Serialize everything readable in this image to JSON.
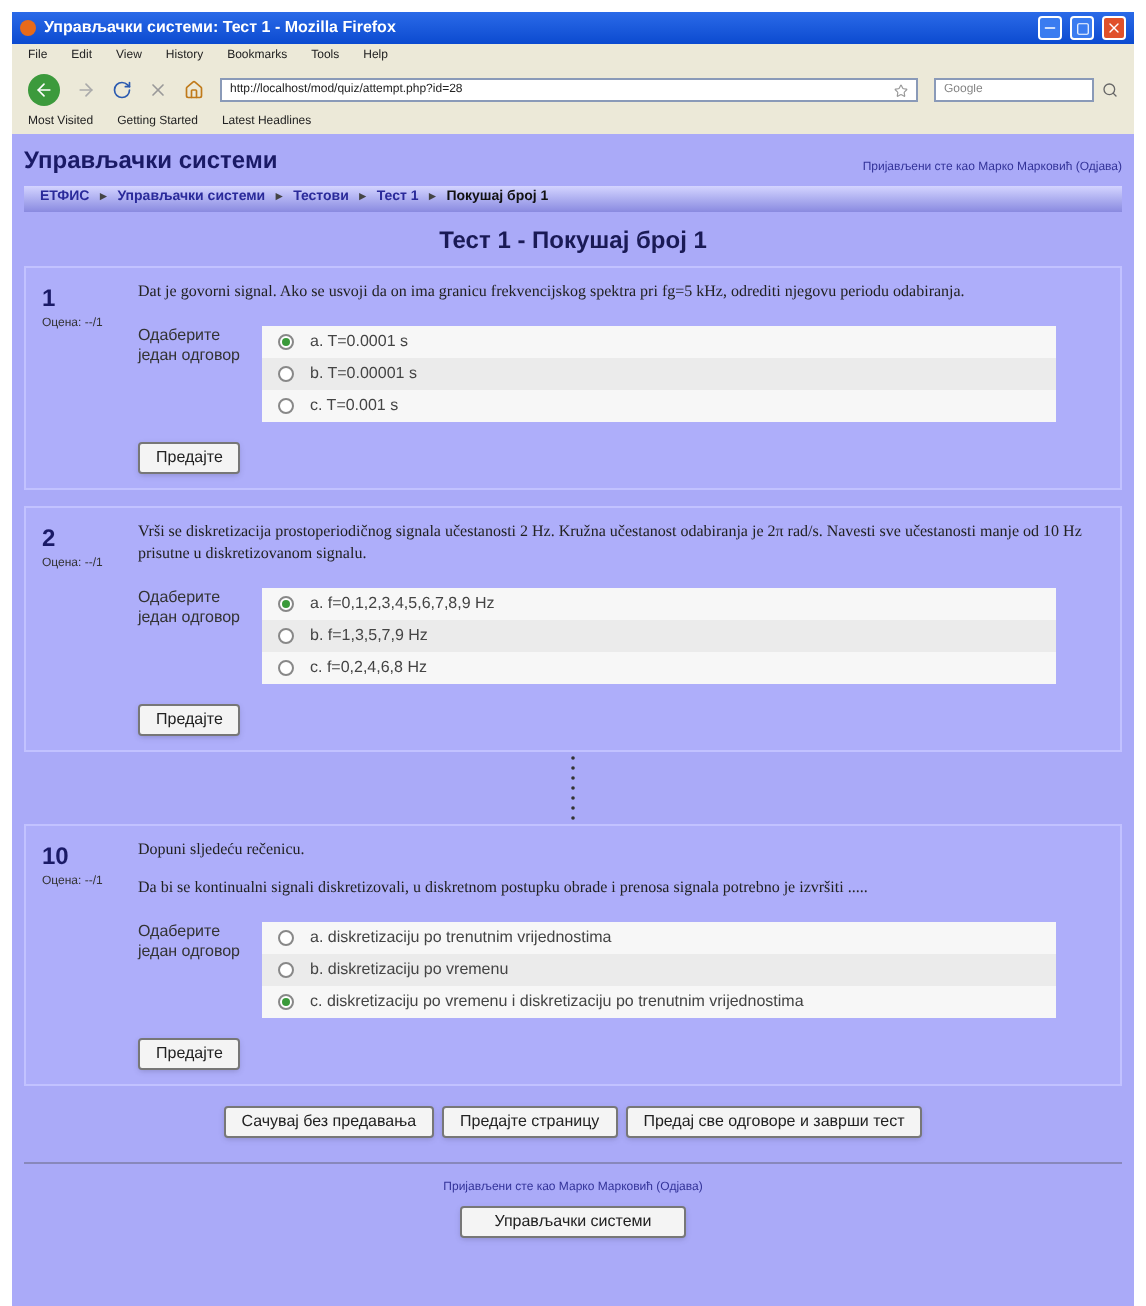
{
  "browser": {
    "title": "Управљачки системи: Тест 1 - Mozilla Firefox",
    "menu": [
      "File",
      "Edit",
      "View",
      "History",
      "Bookmarks",
      "Tools",
      "Help"
    ],
    "url": "http://localhost/mod/quiz/attempt.php?id=28",
    "search_placeholder": "Google",
    "bookmarks": [
      "Most Visited",
      "Getting Started",
      "Latest Headlines"
    ]
  },
  "site": {
    "name": "Управљачки системи",
    "login": "Пријављени сте као Марко Марковић (Одјава)"
  },
  "breadcrumb": {
    "separator": "►",
    "items": [
      "ЕТФИС",
      "Управљачки системи",
      "Тестови",
      "Тест 1",
      "Покушај број 1"
    ]
  },
  "heading": "Тест 1 - Покушај број 1",
  "questions": [
    {
      "number": "1",
      "marks": "Оцена: --/1",
      "paragraphs": [
        "Dat je govorni signal. Ako se usvoji da on ima granicu frekvencijskog spektra pri fg=5 kHz, odrediti njegovu periodu odabiranja."
      ],
      "prompt": "Одаберите један одговор",
      "options": [
        {
          "label": "a. T=0.0001 s",
          "selected": true
        },
        {
          "label": "b. T=0.00001 s",
          "selected": false
        },
        {
          "label": "c. T=0.001 s",
          "selected": false
        }
      ],
      "submit": "Предајте"
    },
    {
      "number": "2",
      "marks": "Оцена: --/1",
      "paragraphs": [
        "Vrši se diskretizacija prostoperiodičnog signala učestanosti 2 Hz. Kružna učestanost odabiranja je 2π rad/s. Navesti sve učestanosti manje od 10 Hz prisutne u diskretizovanom signalu."
      ],
      "prompt": "Одаберите један одговор",
      "options": [
        {
          "label": "a. f=0,1,2,3,4,5,6,7,8,9 Hz",
          "selected": true
        },
        {
          "label": "b. f=1,3,5,7,9 Hz",
          "selected": false
        },
        {
          "label": "c. f=0,2,4,6,8 Hz",
          "selected": false
        }
      ],
      "submit": "Предајте"
    },
    {
      "number": "10",
      "marks": "Оцена: --/1",
      "paragraphs": [
        "Dopuni sljedeću rečenicu.",
        "Da bi se kontinualni signali diskretizovali, u diskretnom postupku obrade i prenosa signala potrebno je izvršiti ....."
      ],
      "prompt": "Одаберите један одговор",
      "options": [
        {
          "label": "a. diskretizaciju po trenutnim vrijednostima",
          "selected": false
        },
        {
          "label": "b. diskretizaciju po vremenu",
          "selected": false
        },
        {
          "label": "c. diskretizaciju po vremenu i diskretizaciju po trenutnim vrijednostima",
          "selected": true
        }
      ],
      "submit": "Предајте"
    }
  ],
  "actions": [
    "Сачувај без предавања",
    "Предајте страницу",
    "Предај све одговоре и заврши тест"
  ],
  "footer": {
    "login": "Пријављени сте као Марко Марковић (Одјава)",
    "button": "Управљачки системи"
  }
}
